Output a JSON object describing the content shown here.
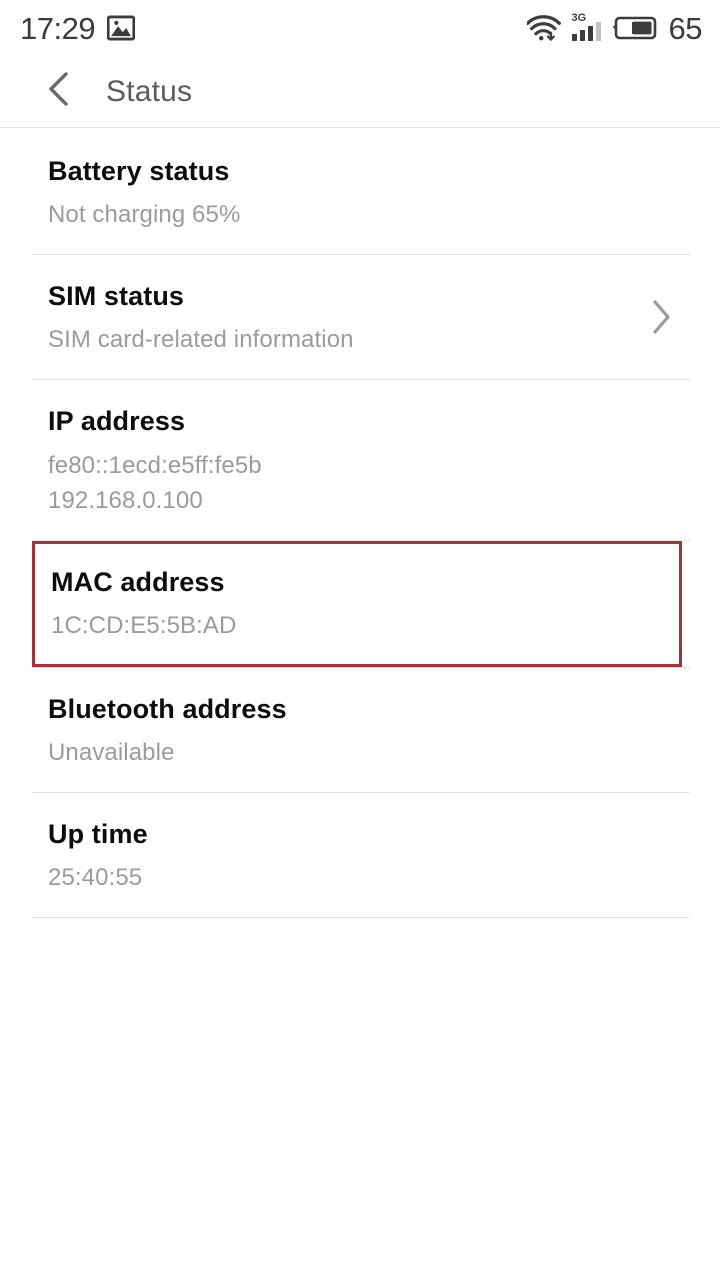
{
  "statusbar": {
    "time": "17:29",
    "photo_icon": "photo-icon",
    "wifi_icon": "wifi-download-icon",
    "network_type": "3G",
    "signal_icon": "signal-bars-icon",
    "battery_icon": "battery-icon",
    "battery_level": "65"
  },
  "appbar": {
    "back_icon": "chevron-left-icon",
    "title": "Status"
  },
  "list": {
    "rows": [
      {
        "name": "battery-status",
        "title": "Battery status",
        "sub": [
          "Not charging 65%"
        ],
        "chevron": false,
        "highlighted": false
      },
      {
        "name": "sim-status",
        "title": "SIM status",
        "sub": [
          "SIM card-related information"
        ],
        "chevron": true,
        "highlighted": false
      },
      {
        "name": "ip-address",
        "title": "IP address",
        "sub": [
          "fe80::1ecd:e5ff:fe5b",
          "192.168.0.100"
        ],
        "chevron": false,
        "highlighted": false
      },
      {
        "name": "mac-address",
        "title": "MAC address",
        "sub": [
          "1C:CD:E5:5B:AD"
        ],
        "chevron": false,
        "highlighted": true
      },
      {
        "name": "bluetooth-address",
        "title": "Bluetooth address",
        "sub": [
          "Unavailable"
        ],
        "chevron": false,
        "highlighted": false
      },
      {
        "name": "up-time",
        "title": "Up time",
        "sub": [
          "25:40:55"
        ],
        "chevron": false,
        "highlighted": false
      }
    ]
  },
  "colors": {
    "highlight_border": "#a8303a",
    "title_text": "#0d0d0d",
    "subtitle_text": "#9b9b9b",
    "appbar_text": "#5b5b5b",
    "divider": "#e3e3e3"
  }
}
